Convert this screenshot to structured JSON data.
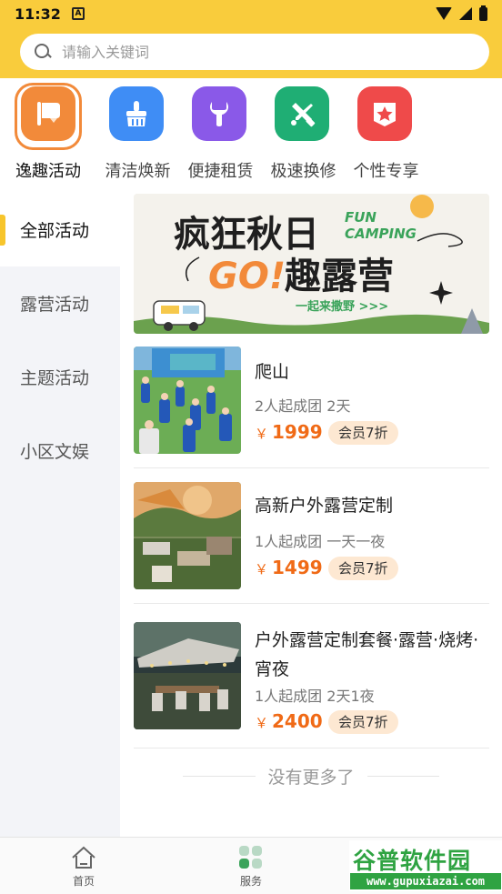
{
  "status_bar": {
    "time": "11:32",
    "notification_letter": "A"
  },
  "search": {
    "placeholder": "请输入关键词"
  },
  "categories": [
    {
      "label": "逸趣活动",
      "icon": "flag-icon",
      "color": "#f28a3a",
      "active": true
    },
    {
      "label": "清洁焕新",
      "icon": "broom-icon",
      "color": "#3f8df5"
    },
    {
      "label": "便捷租赁",
      "icon": "wrench-icon",
      "color": "#8a59e8"
    },
    {
      "label": "极速换修",
      "icon": "tools-icon",
      "color": "#1fae74"
    },
    {
      "label": "个性专享",
      "icon": "star-badge-icon",
      "color": "#ef4a4a"
    }
  ],
  "sidebar": {
    "items": [
      {
        "label": "全部活动",
        "active": true
      },
      {
        "label": "露营活动"
      },
      {
        "label": "主题活动"
      },
      {
        "label": "小区文娱"
      }
    ]
  },
  "banner": {
    "headline": "疯狂秋日",
    "en_line1": "FUN",
    "en_line2": "CAMPING",
    "go": "GO!",
    "subhead": "趣露营",
    "tagline": "一起来撒野 >>>"
  },
  "products": [
    {
      "title": "爬山",
      "sub": "2人起成团 2天",
      "currency": "￥",
      "price": "1999",
      "vip": "会员7折"
    },
    {
      "title": "高新户外露营定制",
      "sub": "1人起成团 一天一夜",
      "currency": "￥",
      "price": "1499",
      "vip": "会员7折"
    },
    {
      "title": "户外露营定制套餐·露营·烧烤·宵夜",
      "sub": "1人起成团 2天1夜",
      "currency": "￥",
      "price": "2400",
      "vip": "会员7折"
    }
  ],
  "no_more": "没有更多了",
  "bottom_nav": [
    {
      "label": "首页",
      "icon": "home-icon"
    },
    {
      "label": "服务",
      "icon": "services-icon"
    }
  ],
  "watermark": {
    "brand": "谷普软件园",
    "url": "www.gupuxiazai.com"
  }
}
